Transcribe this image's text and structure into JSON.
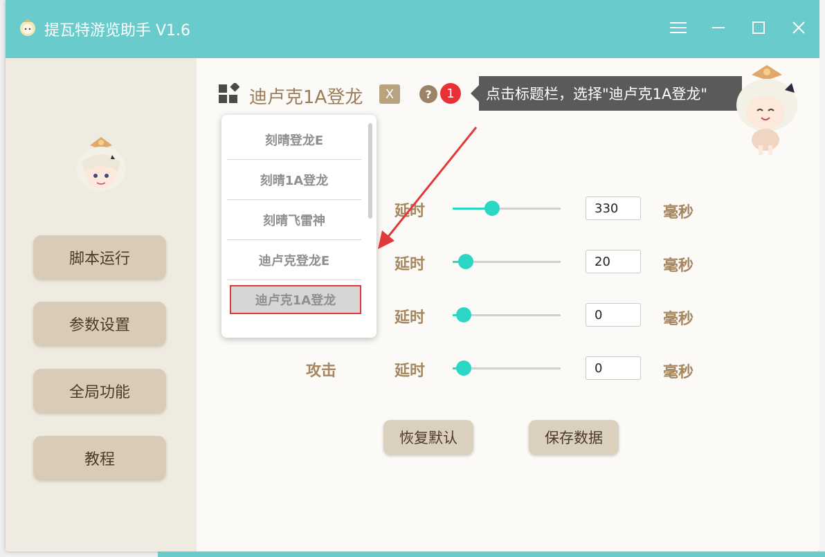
{
  "window": {
    "title": "提瓦特游览助手 V1.6"
  },
  "sidebar": {
    "items": [
      {
        "label": "脚本运行"
      },
      {
        "label": "参数设置"
      },
      {
        "label": "全局功能"
      },
      {
        "label": "教程"
      }
    ]
  },
  "profile": {
    "title": "迪卢克1A登龙",
    "close_label": "X",
    "help_label": "?",
    "step_badge": "1"
  },
  "tooltip": {
    "text": "点击标题栏，选择\"迪卢克1A登龙\""
  },
  "dropdown": {
    "items": [
      {
        "label": "刻晴登龙E"
      },
      {
        "label": "刻晴1A登龙"
      },
      {
        "label": "刻晴飞雷神"
      },
      {
        "label": "迪卢克登龙E"
      },
      {
        "label": "迪卢克1A登龙"
      }
    ],
    "selected_index": 4
  },
  "params": {
    "rows": [
      {
        "name": "",
        "delay_label": "延时",
        "value": "330",
        "unit": "毫秒",
        "slider_fraction": 0.34
      },
      {
        "name": "",
        "delay_label": "延时",
        "value": "20",
        "unit": "毫秒",
        "slider_fraction": 0.06
      },
      {
        "name": "",
        "delay_label": "延时",
        "value": "0",
        "unit": "毫秒",
        "slider_fraction": 0.04
      },
      {
        "name": "攻击",
        "delay_label": "延时",
        "value": "0",
        "unit": "毫秒",
        "slider_fraction": 0.04
      }
    ]
  },
  "actions": {
    "restore_label": "恢复默认",
    "save_label": "保存数据"
  },
  "colors": {
    "titlebar": "#69cbcb",
    "accent": "#2bd6c5",
    "label": "#a5865f",
    "nav_button": "#d8ccb9",
    "highlight": "#e0373a"
  },
  "icons": {
    "app": "paimon-icon",
    "menu": "hamburger-icon",
    "minimize": "minimize-icon",
    "maximize": "maximize-icon",
    "close": "close-icon"
  }
}
